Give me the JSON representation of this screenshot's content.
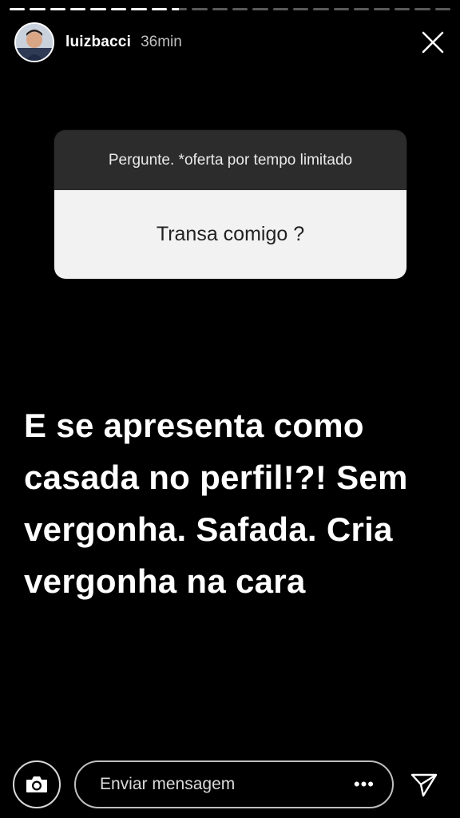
{
  "story": {
    "segment_count": 22,
    "segments_complete": 8,
    "current_segment_progress": 0.45
  },
  "header": {
    "username": "luizbacci",
    "timestamp": "36min",
    "avatar_icon": "profile-photo",
    "close_icon": "close-icon"
  },
  "question_sticker": {
    "prompt": "Pergunte. *oferta por tempo limitado",
    "answer": "Transa comigo ?"
  },
  "caption": {
    "lines": [
      "E se apresenta como",
      "casada no perfil!?! Sem",
      "vergonha. Safada. Cria",
      "vergonha na cara"
    ]
  },
  "footer": {
    "camera_icon": "camera-icon",
    "message_placeholder": "Enviar mensagem",
    "more_label": "•••",
    "send_icon": "send-icon"
  },
  "colors": {
    "background": "#000000",
    "sticker_header": "#2c2c2c",
    "sticker_body": "#f2f2f2"
  }
}
